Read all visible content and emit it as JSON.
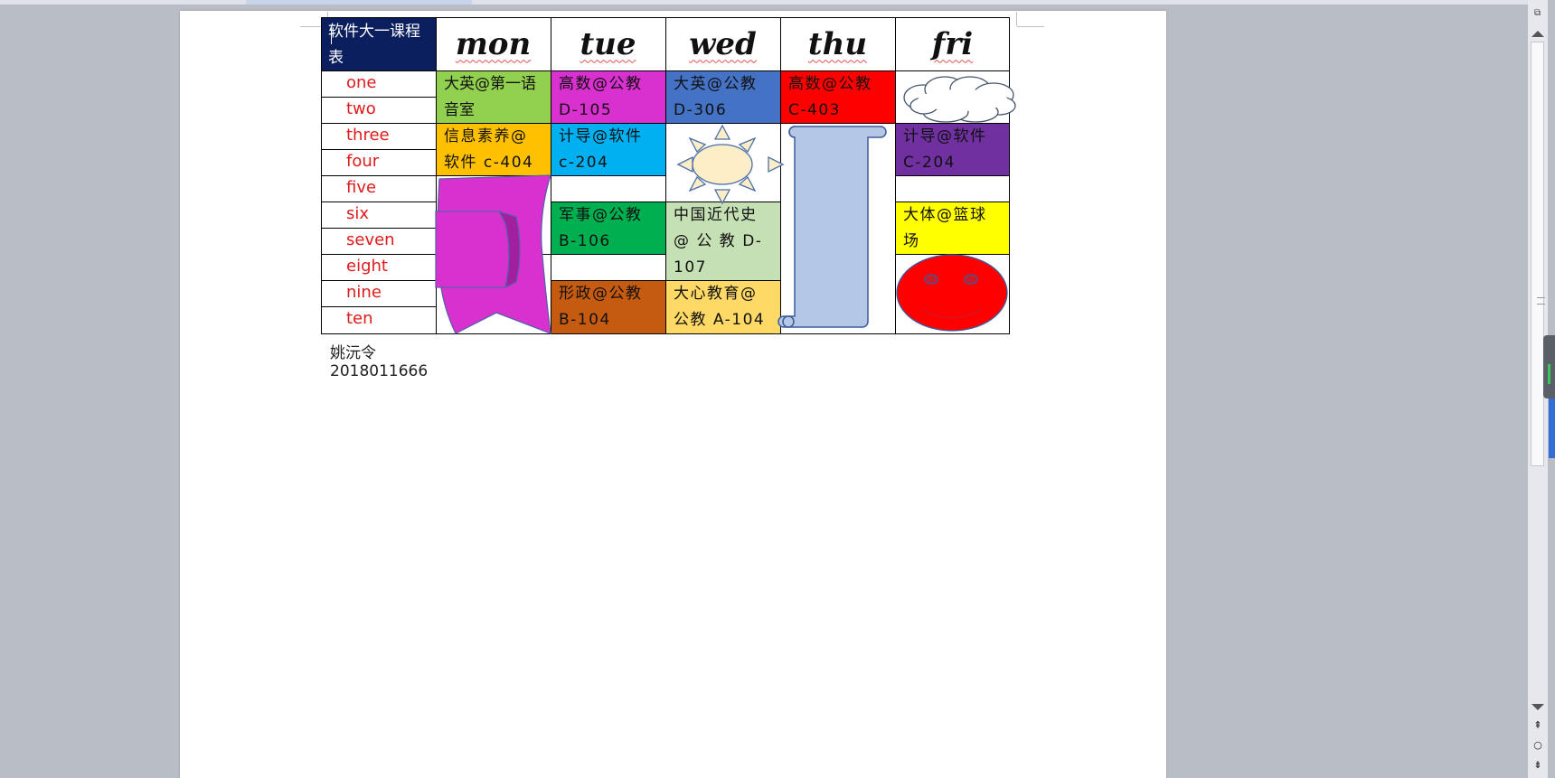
{
  "timetable": {
    "title": "软件大一课程表",
    "days": [
      "mon",
      "tue",
      "wed",
      "thu",
      "fri"
    ],
    "periods": [
      "one",
      "two",
      "three",
      "four",
      "five",
      "six",
      "seven",
      "eight",
      "nine",
      "ten"
    ],
    "courses": {
      "mon_1": "大英@第一语音室",
      "mon_3": "信息素养@软件 c-404",
      "tue_1": "高数@公教 D-105",
      "tue_3": "计导@软件 c-204",
      "tue_6": "军事@公教 B-106",
      "tue_9": "形政@公教 B-104",
      "wed_1": "大英@公教 D-306",
      "wed_6": "中国近代史 @ 公 教 D-107",
      "wed_9": "大心教育@公教 A-104",
      "thu_1": "高数@公教 C-403",
      "fri_3": "计导@软件 C-204",
      "fri_6": "大体@篮球场"
    },
    "colors": {
      "header": "#0b1f5e",
      "mon_1": "#92d050",
      "mon_3": "#ffc000",
      "tue_1": "#d930d0",
      "tue_3": "#00b0f0",
      "tue_6": "#00b050",
      "tue_9": "#c55a11",
      "wed_1": "#4472c4",
      "wed_6": "#c5e0b4",
      "wed_9": "#ffd966",
      "thu_1": "#ff0000",
      "fri_3": "#7030a0",
      "fri_6": "#ffff00",
      "period_text": "#e01b1b"
    },
    "shapes": [
      "cloud-shape",
      "sun-shape",
      "scroll-shape",
      "double-wave-banner-shape",
      "smiley-face-shape"
    ]
  },
  "signature": "姚沅令  2018011666"
}
